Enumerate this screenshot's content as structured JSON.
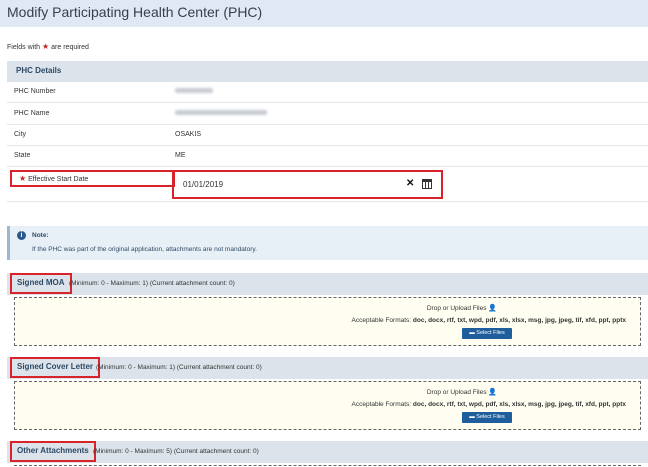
{
  "header": {
    "title": "Modify Participating Health Center (PHC)"
  },
  "required_note": {
    "prefix": "Fields with",
    "suffix": "are required"
  },
  "phc_details": {
    "section_title": "PHC Details",
    "rows": [
      {
        "label": "PHC Number",
        "value": ""
      },
      {
        "label": "PHC Name",
        "value": ""
      },
      {
        "label": "City",
        "value": "OSAKIS"
      },
      {
        "label": "State",
        "value": "ME"
      }
    ],
    "effective_start": {
      "label": "Effective Start Date",
      "value": "01/01/2019"
    }
  },
  "note": {
    "title": "Note:",
    "text": "If the PHC was part of the original application, attachments are not mandatory."
  },
  "attachments": [
    {
      "title": "Signed MOA",
      "meta": "(Minimum: 0 - Maximum: 1) (Current attachment count: 0)"
    },
    {
      "title": "Signed Cover Letter",
      "meta": "(Minimum: 0 - Maximum: 1) (Current attachment count: 0)"
    },
    {
      "title": "Other Attachments",
      "meta": "(Minimum: 0 - Maximum: 5) (Current attachment count: 0)"
    }
  ],
  "dropzone": {
    "drop_text": "Drop or Upload Files",
    "formats_label": "Acceptable Formats:",
    "formats": "doc, docx, rtf, txt, wpd, pdf, xls, xlsx, msg, jpg, jpeg, tif, xfd, ppt, pptx",
    "button_label": "Select Files"
  },
  "icons": {
    "required": "star-icon",
    "clear": "close-icon",
    "calendar": "calendar-icon",
    "info": "info-icon",
    "upload": "upload-icon"
  },
  "colors": {
    "highlight": "#d8232a",
    "required_star": "#c0281e",
    "button": "#1f5e9c",
    "header_bg": "#dfe8f3",
    "dropzone_bg": "#fffef1"
  }
}
